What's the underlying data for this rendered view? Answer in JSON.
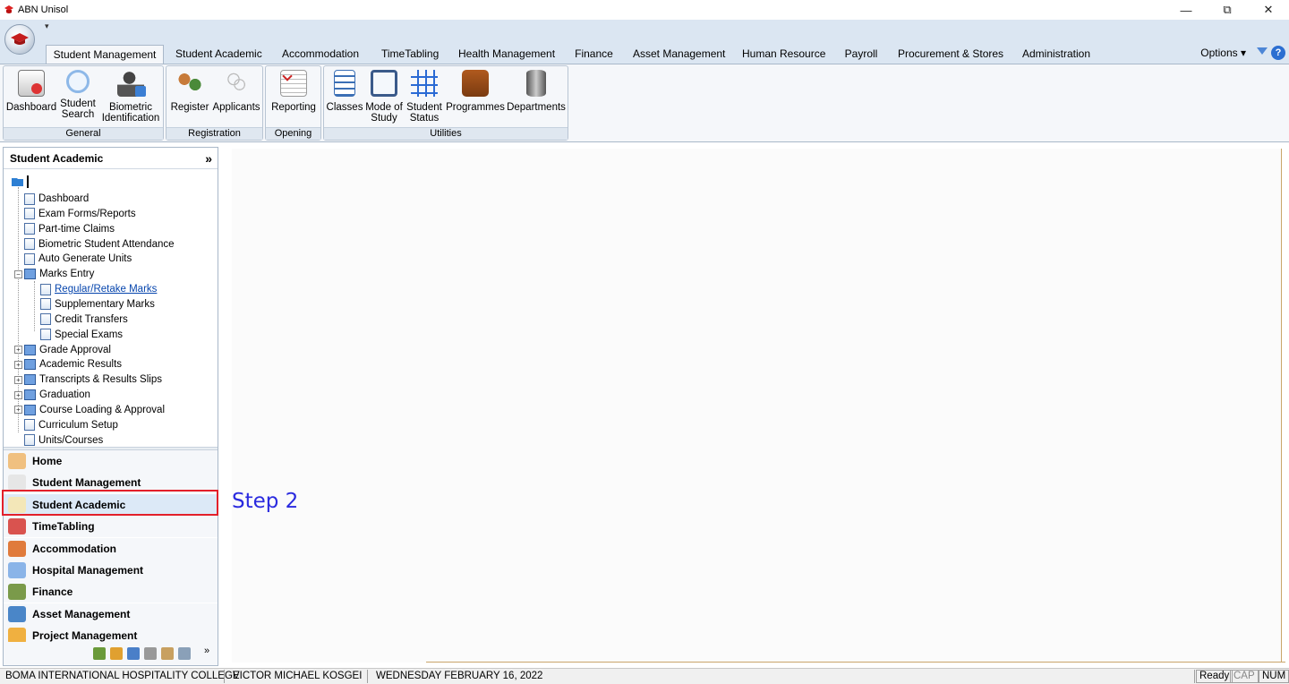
{
  "window": {
    "title": "ABN Unisol",
    "minimize_glyph": "—",
    "restore_glyph": "⧉",
    "close_glyph": "✕"
  },
  "tabs": [
    {
      "label": "Student Management",
      "active": true
    },
    {
      "label": "Student Academic"
    },
    {
      "label": "Accommodation"
    },
    {
      "label": "TimeTabling"
    },
    {
      "label": "Health Management"
    },
    {
      "label": "Finance"
    },
    {
      "label": "Asset Management"
    },
    {
      "label": "Human Resource"
    },
    {
      "label": "Payroll"
    },
    {
      "label": "Procurement & Stores"
    },
    {
      "label": "Administration"
    }
  ],
  "options_label": "Options",
  "ribbon": {
    "general": {
      "label": "General",
      "buttons": [
        {
          "line1": "Dashboard",
          "line2": "",
          "icon": "dashboard-icon"
        },
        {
          "line1": "Student",
          "line2": "Search",
          "icon": "magnifier-icon"
        },
        {
          "line1": "Biometric",
          "line2": "Identification",
          "icon": "biometric-person-icon"
        }
      ]
    },
    "registration": {
      "label": "Registration",
      "buttons": [
        {
          "line1": "Register",
          "line2": "",
          "icon": "register-people-icon"
        },
        {
          "line1": "Applicants",
          "line2": "",
          "icon": "applicants-icon"
        }
      ]
    },
    "opening": {
      "label": "Opening",
      "buttons": [
        {
          "line1": "Reporting",
          "line2": "",
          "icon": "reporting-icon"
        }
      ]
    },
    "utilities": {
      "label": "Utilities",
      "buttons": [
        {
          "line1": "Classes",
          "line2": "",
          "icon": "classes-icon"
        },
        {
          "line1": "Mode of",
          "line2": "Study",
          "icon": "mode-of-study-icon"
        },
        {
          "line1": "Student",
          "line2": "Status",
          "icon": "student-status-icon"
        },
        {
          "line1": "Programmes",
          "line2": "",
          "icon": "programmes-briefcase-icon"
        },
        {
          "line1": "Departments",
          "line2": "",
          "icon": "departments-database-icon"
        }
      ]
    }
  },
  "nav": {
    "header": "Student Academic",
    "tree": [
      {
        "label": "Dashboard",
        "type": "doc",
        "level": 1
      },
      {
        "label": "Exam Forms/Reports",
        "type": "doc",
        "level": 1
      },
      {
        "label": "Part-time Claims",
        "type": "doc",
        "level": 1
      },
      {
        "label": "Biometric Student Attendance",
        "type": "doc",
        "level": 1
      },
      {
        "label": "Auto Generate Units",
        "type": "doc",
        "level": 1
      },
      {
        "label": "Marks Entry",
        "type": "book",
        "level": 1,
        "expander": "−"
      },
      {
        "label": "Regular/Retake Marks",
        "type": "doc",
        "level": 2,
        "link": true
      },
      {
        "label": "Supplementary Marks",
        "type": "doc",
        "level": 2
      },
      {
        "label": "Credit Transfers",
        "type": "doc",
        "level": 2
      },
      {
        "label": "Special Exams",
        "type": "doc",
        "level": 2
      },
      {
        "label": "Grade Approval",
        "type": "book",
        "level": 1,
        "expander": "+"
      },
      {
        "label": "Academic Results",
        "type": "book",
        "level": 1,
        "expander": "+"
      },
      {
        "label": "Transcripts & Results Slips",
        "type": "book",
        "level": 1,
        "expander": "+"
      },
      {
        "label": "Graduation",
        "type": "book",
        "level": 1,
        "expander": "+"
      },
      {
        "label": "Course Loading & Approval",
        "type": "book",
        "level": 1,
        "expander": "+"
      },
      {
        "label": "Curriculum Setup",
        "type": "doc",
        "level": 1
      },
      {
        "label": "Units/Courses",
        "type": "doc",
        "level": 1
      }
    ],
    "modules": [
      {
        "label": "Home",
        "icon": "home-icon",
        "color": "#f0c080"
      },
      {
        "label": "Student Management",
        "icon": "student-management-icon",
        "color": "#e6e6e6"
      },
      {
        "label": "Student Academic",
        "icon": "student-academic-icon",
        "color": "#f3e7b8",
        "selected": true
      },
      {
        "label": "TimeTabling",
        "icon": "calendar-icon",
        "color": "#d9534f"
      },
      {
        "label": "Accommodation",
        "icon": "house-icon",
        "color": "#e07b3c"
      },
      {
        "label": "Hospital Management",
        "icon": "pill-icon",
        "color": "#8ab4e8"
      },
      {
        "label": "Finance",
        "icon": "finance-icon",
        "color": "#7a9a4a"
      },
      {
        "label": "Asset Management",
        "icon": "building-icon",
        "color": "#4a86c8"
      },
      {
        "label": "Project Management",
        "icon": "project-icon",
        "color": "#f0b040"
      }
    ]
  },
  "annotation": "Step 2",
  "status": {
    "institution": "BOMA INTERNATIONAL HOSPITALITY COLLEGE",
    "user": "VICTOR MICHAEL KOSGEI",
    "date": "WEDNESDAY FEBRUARY 16, 2022",
    "ready": "Ready",
    "cap": "CAP",
    "num": "NUM"
  }
}
